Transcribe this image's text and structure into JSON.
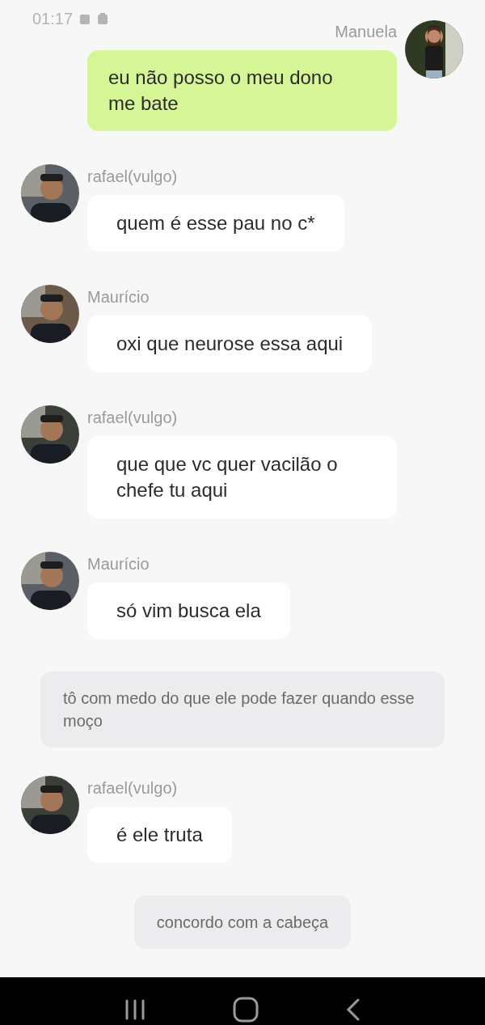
{
  "status_bar": {
    "time": "01:17"
  },
  "messages": [
    {
      "kind": "self",
      "sender": "Manuela",
      "text": "eu não posso o meu dono me bate"
    },
    {
      "kind": "other",
      "sender": "rafael(vulgo)",
      "text": "quem é esse pau no c*"
    },
    {
      "kind": "other",
      "sender": "Maurício",
      "text": "oxi que neurose essa aqui"
    },
    {
      "kind": "other",
      "sender": "rafael(vulgo)",
      "text": "que que vc quer vacilão o chefe tu aqui"
    },
    {
      "kind": "other",
      "sender": "Maurício",
      "text": "só vim busca ela"
    },
    {
      "kind": "narration",
      "text": "tô com medo do que ele pode fazer quando esse moço"
    },
    {
      "kind": "other",
      "sender": "rafael(vulgo)",
      "text": "é ele truta"
    },
    {
      "kind": "narration",
      "text": "concordo com a cabeça"
    }
  ]
}
